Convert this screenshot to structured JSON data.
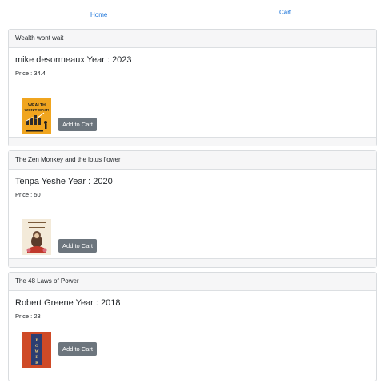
{
  "nav": {
    "home_label": "Home",
    "cart_label": "Cart"
  },
  "books": [
    {
      "header": "Wealth wont wait",
      "title": "mike desormeaux Year : 2023",
      "price": "Price : 34.4",
      "button_label": "Add to Cart",
      "cover_icon": "wealth-wont-wait-cover",
      "cover_text": [
        "WEALTH",
        "WON'T WAIT!"
      ],
      "cover_colors": {
        "bg": "#f0a51f",
        "text": "#1d1d1d"
      }
    },
    {
      "header": "The Zen Monkey and the lotus flower",
      "title": "Tenpa Yeshe Year : 2020",
      "price": "Price : 50",
      "button_label": "Add to Cart",
      "cover_icon": "zen-monkey-cover",
      "cover_colors": {
        "bg": "#f3ead9",
        "accent": "#c0392b"
      }
    },
    {
      "header": "The 48 Laws of Power",
      "title": "Robert Greene Year : 2018",
      "price": "Price : 23",
      "button_label": "Add to Cart",
      "cover_icon": "48-laws-of-power-cover",
      "cover_text": [
        "POWER"
      ],
      "cover_colors": {
        "bg": "#cf4a27",
        "text": "#f3d37a"
      }
    }
  ],
  "colors": {
    "link": "#1a73d9",
    "button": "#6c757d",
    "header_bg": "#f6f6f7"
  }
}
